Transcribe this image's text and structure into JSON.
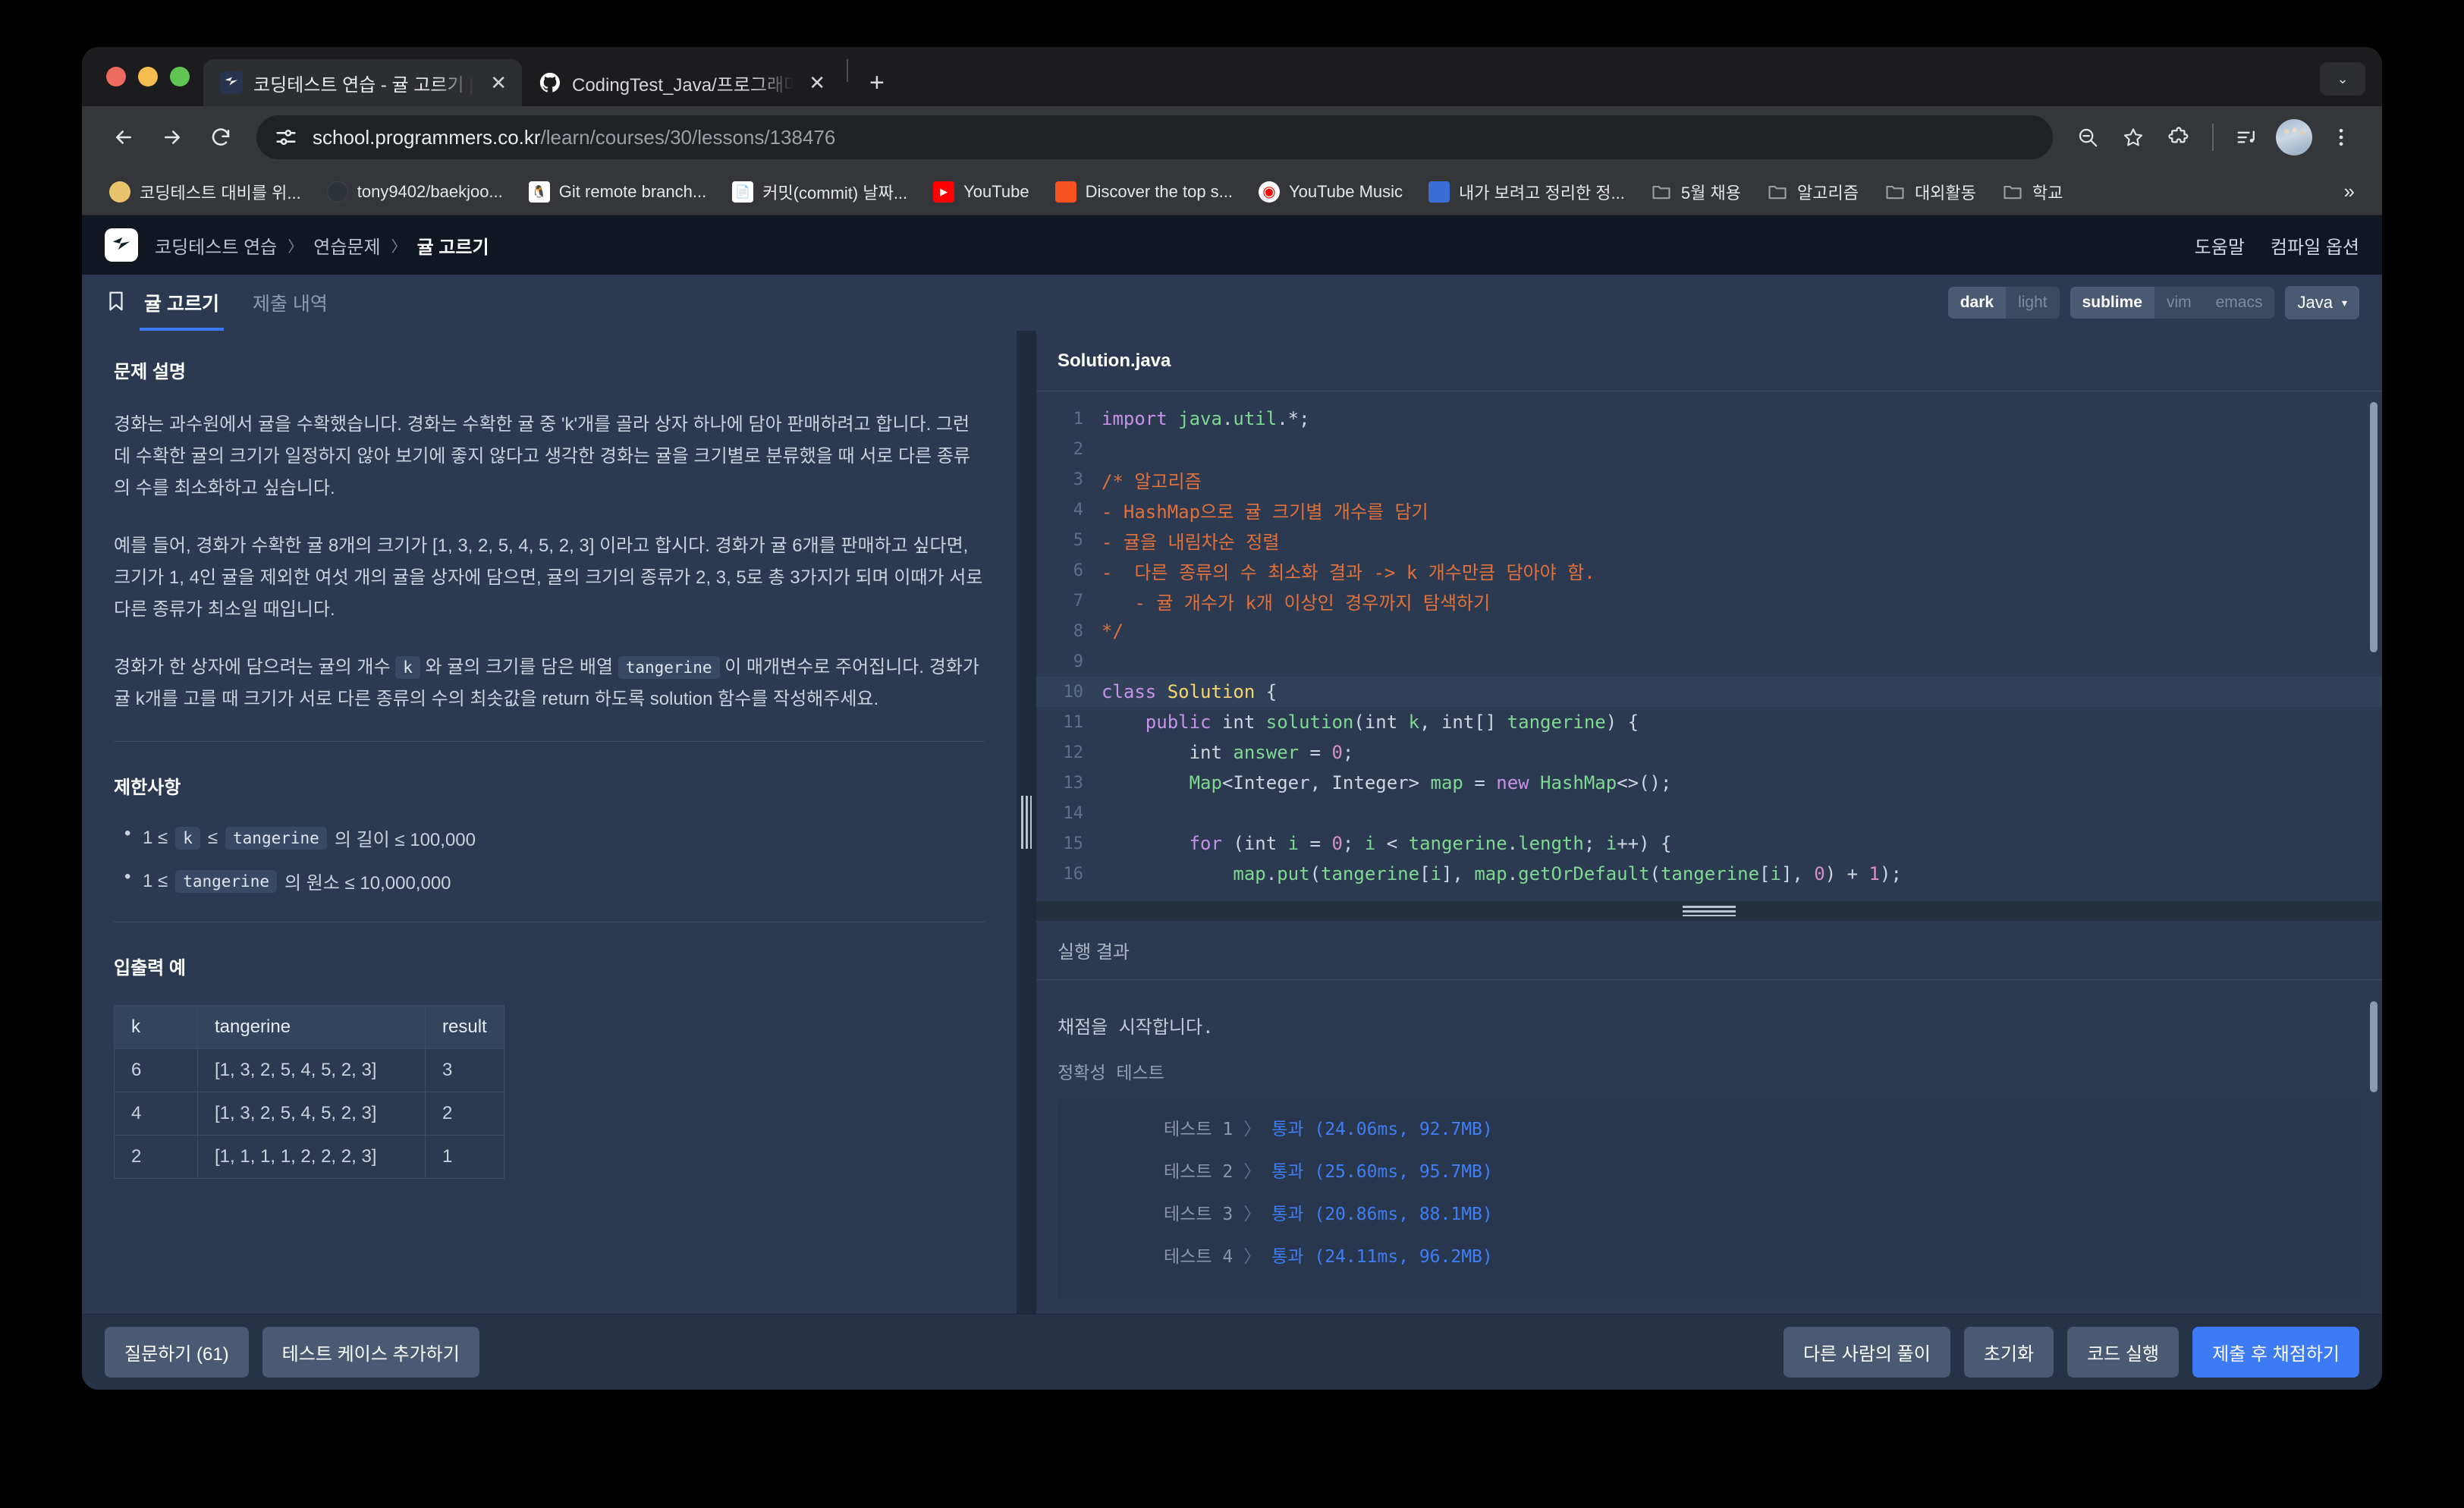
{
  "browser": {
    "tabs": [
      {
        "title": "코딩테스트 연습 - 귤 고르기 | 프로",
        "favicon": "programmers-icon",
        "active": true,
        "close_label": "✕"
      },
      {
        "title": "CodingTest_Java/프로그래머스/",
        "favicon": "github-icon",
        "active": false,
        "close_label": "✕"
      }
    ],
    "new_tab_label": "+",
    "window_menu_label": "⌄",
    "url_host": "school.programmers.co.kr",
    "url_path": "/learn/courses/30/lessons/138476",
    "toolbar_icons": [
      "back-arrow-icon",
      "forward-arrow-icon",
      "reload-icon",
      "site-info-icon",
      "zoom-out-icon",
      "bookmark-star-icon",
      "extensions-icon",
      "media-list-icon",
      "profile-avatar",
      "three-dot-menu-icon"
    ],
    "bookmarks": [
      {
        "label": "코딩테스트 대비를 위...",
        "icon": "yellow-circle-icon",
        "color": "#e9c46a"
      },
      {
        "label": "tony9402/baekjoo...",
        "icon": "dark-circle-icon",
        "color": "#2b3238"
      },
      {
        "label": "Git remote branch...",
        "icon": "penguin-icon",
        "color": "#ffffff"
      },
      {
        "label": "커밋(commit) 날짜...",
        "icon": "doc-icon",
        "color": "#ffffff"
      },
      {
        "label": "YouTube",
        "icon": "youtube-icon",
        "color": "#ff0000"
      },
      {
        "label": "Discover the top s...",
        "icon": "orange-square-icon",
        "color": "#f4511e"
      },
      {
        "label": "YouTube Music",
        "icon": "youtube-music-icon",
        "color": "#ff0000"
      },
      {
        "label": "내가 보려고 정리한 정...",
        "icon": "blue-book-icon",
        "color": "#3b6ed4"
      },
      {
        "label": "5월 채용",
        "icon": "folder-icon",
        "color": "#9aa0a6"
      },
      {
        "label": "알고리즘",
        "icon": "folder-icon",
        "color": "#9aa0a6"
      },
      {
        "label": "대외활동",
        "icon": "folder-icon",
        "color": "#9aa0a6"
      },
      {
        "label": "학교",
        "icon": "folder-icon",
        "color": "#9aa0a6"
      }
    ],
    "bookmarks_overflow_label": "»"
  },
  "site": {
    "logo": "programmers-logo",
    "breadcrumb": {
      "level1": "코딩테스트 연습",
      "level2": "연습문제",
      "current": "귤 고르기",
      "separator": "〉"
    },
    "header_links": {
      "help": "도움말",
      "compile_options": "컴파일 옵션"
    }
  },
  "problem_tabs": {
    "bookmark_icon": "bookmark-flag-icon",
    "active": "귤 고르기",
    "history": "제출 내역"
  },
  "editor_options": {
    "theme": {
      "dark": "dark",
      "light": "light",
      "selected": "dark"
    },
    "keymap": {
      "sublime": "sublime",
      "vim": "vim",
      "emacs": "emacs",
      "selected": "sublime"
    },
    "language": "Java",
    "language_caret": "▾"
  },
  "problem": {
    "description_heading": "문제 설명",
    "paragraphs": [
      "경화는 과수원에서 귤을 수확했습니다. 경화는 수확한 귤 중 'k'개를 골라 상자 하나에 담아 판매하려고 합니다. 그런데 수확한 귤의 크기가 일정하지 않아 보기에 좋지 않다고 생각한 경화는 귤을 크기별로 분류했을 때 서로 다른 종류의 수를 최소화하고 싶습니다.",
      "예를 들어, 경화가 수확한 귤 8개의 크기가 [1, 3, 2, 5, 4, 5, 2, 3] 이라고 합시다. 경화가 귤 6개를 판매하고 싶다면, 크기가 1, 4인 귤을 제외한 여섯 개의 귤을 상자에 담으면, 귤의 크기의 종류가 2, 3, 5로 총 3가지가 되며 이때가 서로 다른 종류가 최소일 때입니다."
    ],
    "param_paragraph": {
      "before": "경화가 한 상자에 담으려는 귤의 개수",
      "code1": "k",
      "middle": "와 귤의 크기를 담은 배열",
      "code2": "tangerine",
      "after": "이 매개변수로 주어집니다. 경화가 귤 k개를 고를 때 크기가 서로 다른 종류의 수의 최솟값을 return 하도록 solution 함수를 작성해주세요."
    },
    "constraints_heading": "제한사항",
    "constraints": [
      {
        "p1": "1 ≤",
        "c1": "k",
        "p2": "≤",
        "c2": "tangerine",
        "p3": "의 길이 ≤ 100,000"
      },
      {
        "p1": "1 ≤",
        "c1": "",
        "p2": "",
        "c2": "tangerine",
        "p3": "의 원소 ≤ 10,000,000"
      }
    ],
    "examples_heading": "입출력 예",
    "table": {
      "headers": [
        "k",
        "tangerine",
        "result"
      ],
      "rows": [
        [
          "6",
          "[1, 3, 2, 5, 4, 5, 2, 3]",
          "3"
        ],
        [
          "4",
          "[1, 3, 2, 5, 4, 5, 2, 3]",
          "2"
        ],
        [
          "2",
          "[1, 1, 1, 1, 2, 2, 2, 3]",
          "1"
        ]
      ]
    }
  },
  "code": {
    "filename": "Solution.java",
    "highlighted_line": 10,
    "lines": [
      {
        "n": 1,
        "tokens": [
          {
            "t": "import ",
            "c": "k"
          },
          {
            "t": "java",
            "c": "t"
          },
          {
            "t": ".",
            "c": "p"
          },
          {
            "t": "util",
            "c": "t"
          },
          {
            "t": ".*;",
            "c": "p"
          }
        ]
      },
      {
        "n": 2,
        "tokens": []
      },
      {
        "n": 3,
        "tokens": [
          {
            "t": "/* 알고리즘",
            "c": "cm"
          }
        ]
      },
      {
        "n": 4,
        "tokens": [
          {
            "t": "- HashMap으로 귤 크기별 개수를 담기",
            "c": "cm"
          }
        ]
      },
      {
        "n": 5,
        "tokens": [
          {
            "t": "- 귤을 내림차순 정렬",
            "c": "cm"
          }
        ]
      },
      {
        "n": 6,
        "tokens": [
          {
            "t": "-  다른 종류의 수 최소화 결과 -> k 개수만큼 담아야 함.",
            "c": "cm"
          }
        ]
      },
      {
        "n": 7,
        "tokens": [
          {
            "t": "   - 귤 개수가 k개 이상인 경우까지 탐색하기",
            "c": "cm"
          }
        ]
      },
      {
        "n": 8,
        "tokens": [
          {
            "t": "*/",
            "c": "cm"
          }
        ]
      },
      {
        "n": 9,
        "tokens": []
      },
      {
        "n": 10,
        "tokens": [
          {
            "t": "class ",
            "c": "k"
          },
          {
            "t": "Solution",
            "c": "s"
          },
          {
            "t": " {",
            "c": "p"
          }
        ]
      },
      {
        "n": 11,
        "tokens": [
          {
            "t": "    ",
            "c": "p"
          },
          {
            "t": "public ",
            "c": "k"
          },
          {
            "t": "int ",
            "c": "p"
          },
          {
            "t": "solution",
            "c": "t"
          },
          {
            "t": "(",
            "c": "p"
          },
          {
            "t": "int ",
            "c": "p"
          },
          {
            "t": "k",
            "c": "t"
          },
          {
            "t": ", ",
            "c": "p"
          },
          {
            "t": "int",
            "c": "p"
          },
          {
            "t": "[] ",
            "c": "p"
          },
          {
            "t": "tangerine",
            "c": "t"
          },
          {
            "t": ") {",
            "c": "p"
          }
        ]
      },
      {
        "n": 12,
        "tokens": [
          {
            "t": "        ",
            "c": "p"
          },
          {
            "t": "int ",
            "c": "p"
          },
          {
            "t": "answer",
            "c": "t"
          },
          {
            "t": " = ",
            "c": "p"
          },
          {
            "t": "0",
            "c": "n"
          },
          {
            "t": ";",
            "c": "p"
          }
        ]
      },
      {
        "n": 13,
        "tokens": [
          {
            "t": "        ",
            "c": "p"
          },
          {
            "t": "Map",
            "c": "t"
          },
          {
            "t": "<",
            "c": "p"
          },
          {
            "t": "Integer",
            "c": "p"
          },
          {
            "t": ", ",
            "c": "p"
          },
          {
            "t": "Integer",
            "c": "p"
          },
          {
            "t": "> ",
            "c": "p"
          },
          {
            "t": "map",
            "c": "t"
          },
          {
            "t": " = ",
            "c": "p"
          },
          {
            "t": "new ",
            "c": "k"
          },
          {
            "t": "HashMap",
            "c": "t"
          },
          {
            "t": "<>();",
            "c": "p"
          }
        ]
      },
      {
        "n": 14,
        "tokens": []
      },
      {
        "n": 15,
        "tokens": [
          {
            "t": "        ",
            "c": "p"
          },
          {
            "t": "for ",
            "c": "k"
          },
          {
            "t": "(",
            "c": "p"
          },
          {
            "t": "int ",
            "c": "p"
          },
          {
            "t": "i",
            "c": "t"
          },
          {
            "t": " = ",
            "c": "p"
          },
          {
            "t": "0",
            "c": "n"
          },
          {
            "t": "; ",
            "c": "p"
          },
          {
            "t": "i",
            "c": "t"
          },
          {
            "t": " < ",
            "c": "p"
          },
          {
            "t": "tangerine",
            "c": "t"
          },
          {
            "t": ".",
            "c": "p"
          },
          {
            "t": "length",
            "c": "t"
          },
          {
            "t": "; ",
            "c": "p"
          },
          {
            "t": "i",
            "c": "t"
          },
          {
            "t": "++) {",
            "c": "p"
          }
        ]
      },
      {
        "n": 16,
        "tokens": [
          {
            "t": "            ",
            "c": "p"
          },
          {
            "t": "map",
            "c": "t"
          },
          {
            "t": ".",
            "c": "p"
          },
          {
            "t": "put",
            "c": "t"
          },
          {
            "t": "(",
            "c": "p"
          },
          {
            "t": "tangerine",
            "c": "t"
          },
          {
            "t": "[",
            "c": "p"
          },
          {
            "t": "i",
            "c": "t"
          },
          {
            "t": "], ",
            "c": "p"
          },
          {
            "t": "map",
            "c": "t"
          },
          {
            "t": ".",
            "c": "p"
          },
          {
            "t": "getOrDefault",
            "c": "t"
          },
          {
            "t": "(",
            "c": "p"
          },
          {
            "t": "tangerine",
            "c": "t"
          },
          {
            "t": "[",
            "c": "p"
          },
          {
            "t": "i",
            "c": "t"
          },
          {
            "t": "], ",
            "c": "p"
          },
          {
            "t": "0",
            "c": "n"
          },
          {
            "t": ") + ",
            "c": "p"
          },
          {
            "t": "1",
            "c": "n"
          },
          {
            "t": ");",
            "c": "p"
          }
        ]
      }
    ]
  },
  "result": {
    "heading": "실행 결과",
    "start_message": "채점을 시작합니다.",
    "section_label": "정확성  테스트",
    "tests": [
      {
        "name": "테스트 1",
        "arrow": "〉",
        "status": "통과 (24.06ms, 92.7MB)"
      },
      {
        "name": "테스트 2",
        "arrow": "〉",
        "status": "통과 (25.60ms, 95.7MB)"
      },
      {
        "name": "테스트 3",
        "arrow": "〉",
        "status": "통과 (20.86ms, 88.1MB)"
      },
      {
        "name": "테스트 4",
        "arrow": "〉",
        "status": "통과 (24.11ms, 96.2MB)"
      }
    ]
  },
  "bottom_bar": {
    "ask_question": "질문하기 (61)",
    "add_test_case": "테스트 케이스 추가하기",
    "others_solutions": "다른 사람의 풀이",
    "reset": "초기화",
    "run_code": "코드 실행",
    "submit": "제출 후 채점하기"
  },
  "colors": {
    "accent_blue": "#3d7af5",
    "page_bg": "#2b3a50",
    "header_bg": "#101723",
    "pass_blue": "#3f7ef5",
    "comment_orange": "#e2703a"
  }
}
